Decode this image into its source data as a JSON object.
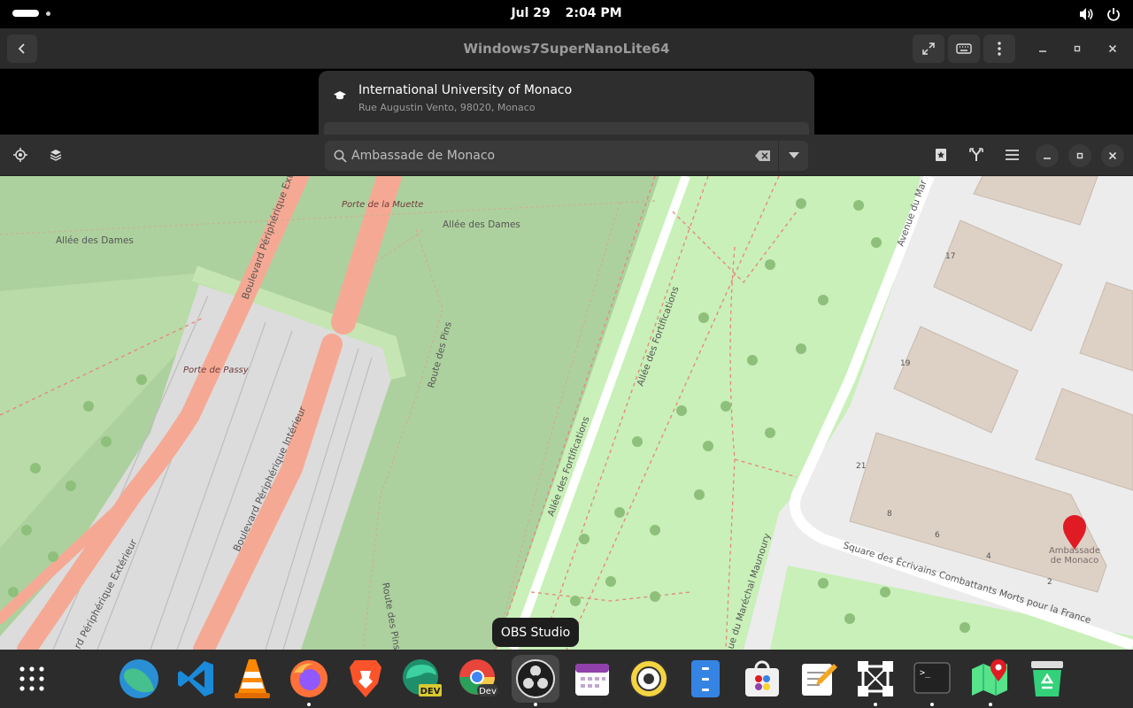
{
  "topbar": {
    "date": "Jul 29",
    "time": "2:04 PM"
  },
  "remote_window": {
    "title": "Windows7SuperNanoLite64"
  },
  "popover": {
    "result_name": "International University of Monaco",
    "result_address": "Rue Augustin Vento, 98020, Monaco"
  },
  "maps": {
    "search_value": "Ambassade de Monaco"
  },
  "map_labels": {
    "porte_muette": "Porte de la Muette",
    "allee_dames_1": "Allée des Dames",
    "allee_dames_2": "Allée des Dames",
    "bd_periph_ext_top": "Boulevard Périphérique Ext",
    "porte_passy": "Porte de Passy",
    "route_pins_1": "Route des Pins",
    "route_pins_2": "Route des Pins",
    "bd_periph_int": "Boulevard Périphérique Intérieur",
    "bd_periph_ext": "rd Périphérique Extérieur",
    "allee_fortif_1": "Allée des Fortifications",
    "allee_fortif_2": "Allée des Fortifications",
    "avenue": "Avenue du Mar",
    "marechal": "ue du Maréchal Maunoury",
    "square": "Square des Écrivains Combattants Morts pour la France",
    "embassy_line1": "Ambassade",
    "embassy_line2": "de Monaco",
    "num_17": "17",
    "num_19": "19",
    "num_21": "21",
    "num_8": "8",
    "num_6": "6",
    "num_4": "4",
    "num_2": "2"
  },
  "tooltip": "OBS Studio",
  "dock": {
    "apps": [
      "Show Apps",
      "Earth",
      "VS Code",
      "VLC",
      "Firefox",
      "Brave",
      "Edge Dev",
      "Chrome Dev",
      "OBS Studio",
      "Calendar",
      "Audio",
      "Files",
      "Store",
      "Text Editor",
      "Inkscape",
      "Terminal",
      "Maps",
      "Trash"
    ]
  },
  "colors": {
    "motorway": "#f5a994",
    "park": "#c8e6b0",
    "forest": "#add19e",
    "building": "#ddd1c6",
    "pin": "#e01b24"
  }
}
